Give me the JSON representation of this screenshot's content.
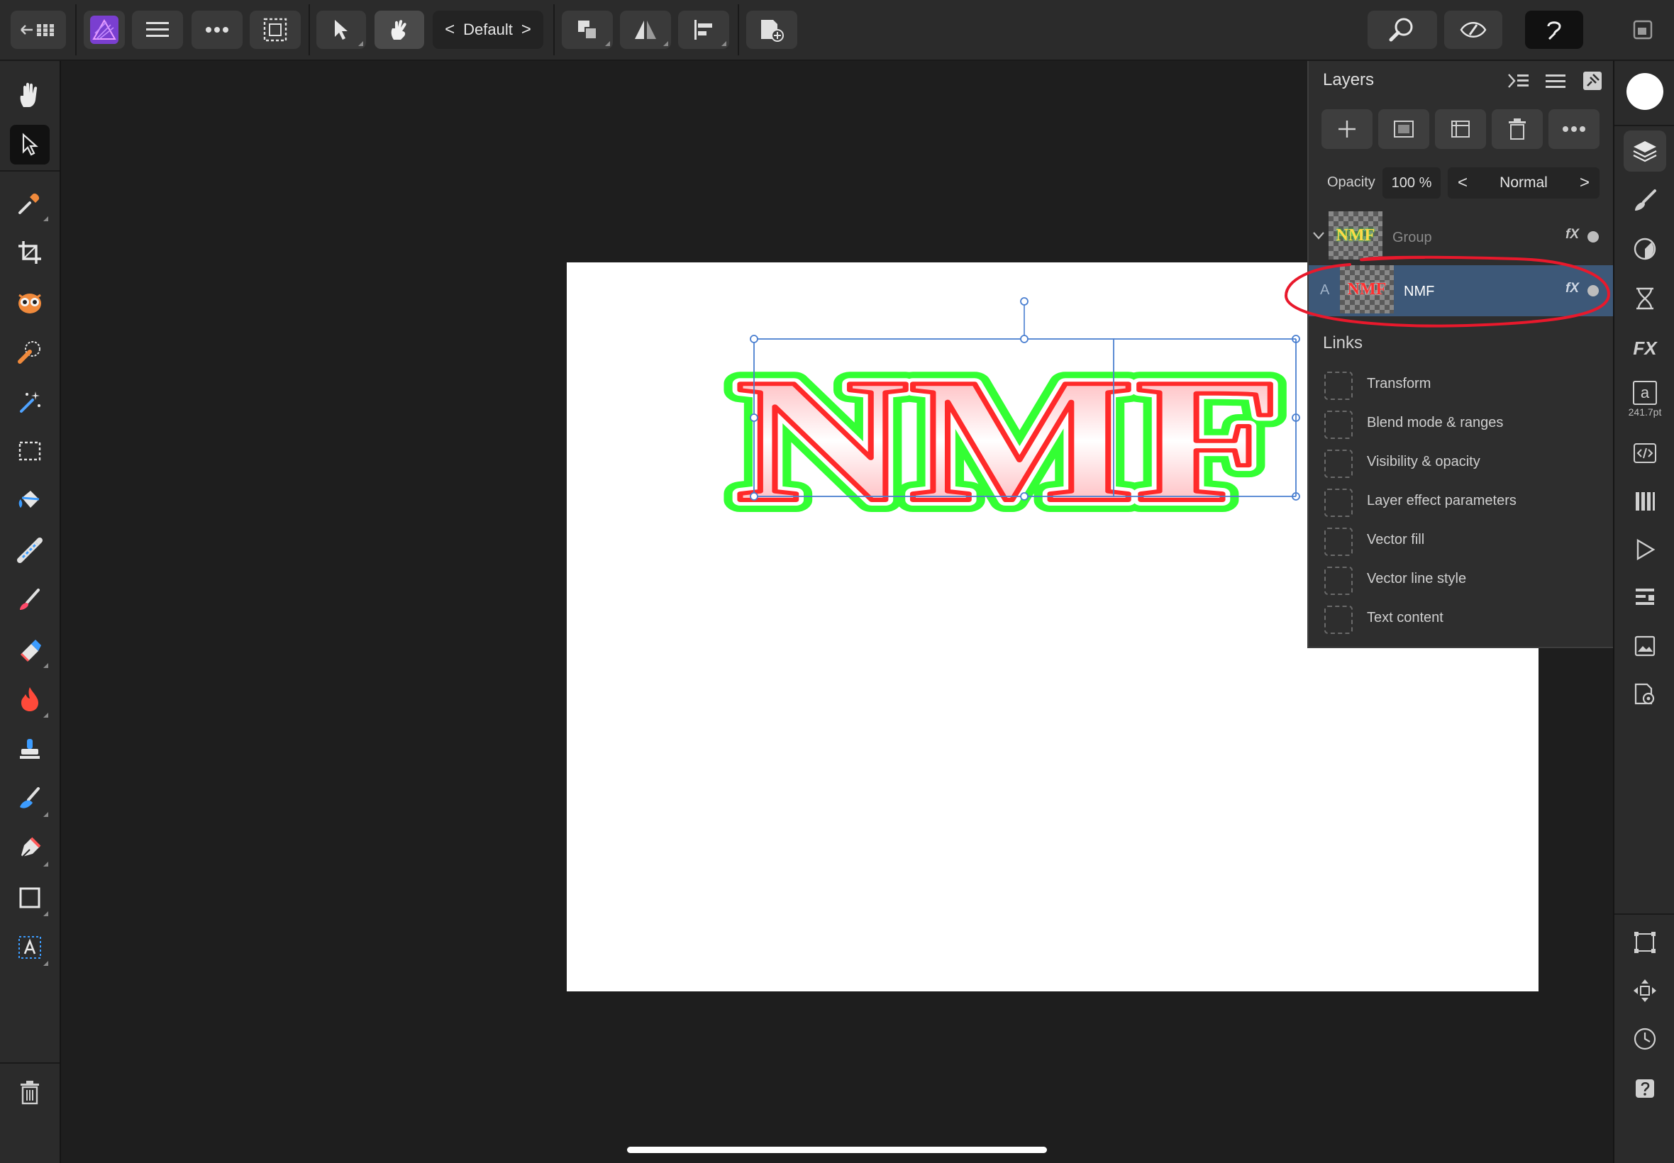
{
  "toolbar": {
    "persona_label": "Default",
    "prev_label": "<",
    "next_label": ">"
  },
  "layers": {
    "title": "Layers",
    "opacity_label": "Opacity",
    "opacity_value": "100 %",
    "blend_mode": "Normal",
    "blend_prev": "<",
    "blend_next": ">",
    "group_thumb_text": "NMF",
    "group_name": "Group",
    "nmf_thumb_text": "NMF",
    "nmf_prefix": "A",
    "nmf_name": "NMF",
    "fx_badge": "fX"
  },
  "links": {
    "title": "Links",
    "items": [
      "Transform",
      "Blend mode & ranges",
      "Visibility & opacity",
      "Layer effect parameters",
      "Vector fill",
      "Vector line style",
      "Text content"
    ]
  },
  "canvas": {
    "text": "NMF"
  },
  "studio": {
    "font_size_readout": "241.7pt",
    "character_glyph": "a",
    "fx_label": "FX"
  },
  "colors": {
    "accent_selection": "#3d5878",
    "text_fill": "#ff2a2a",
    "outer_glow": "#33ff33",
    "annotation": "#e8192c"
  }
}
